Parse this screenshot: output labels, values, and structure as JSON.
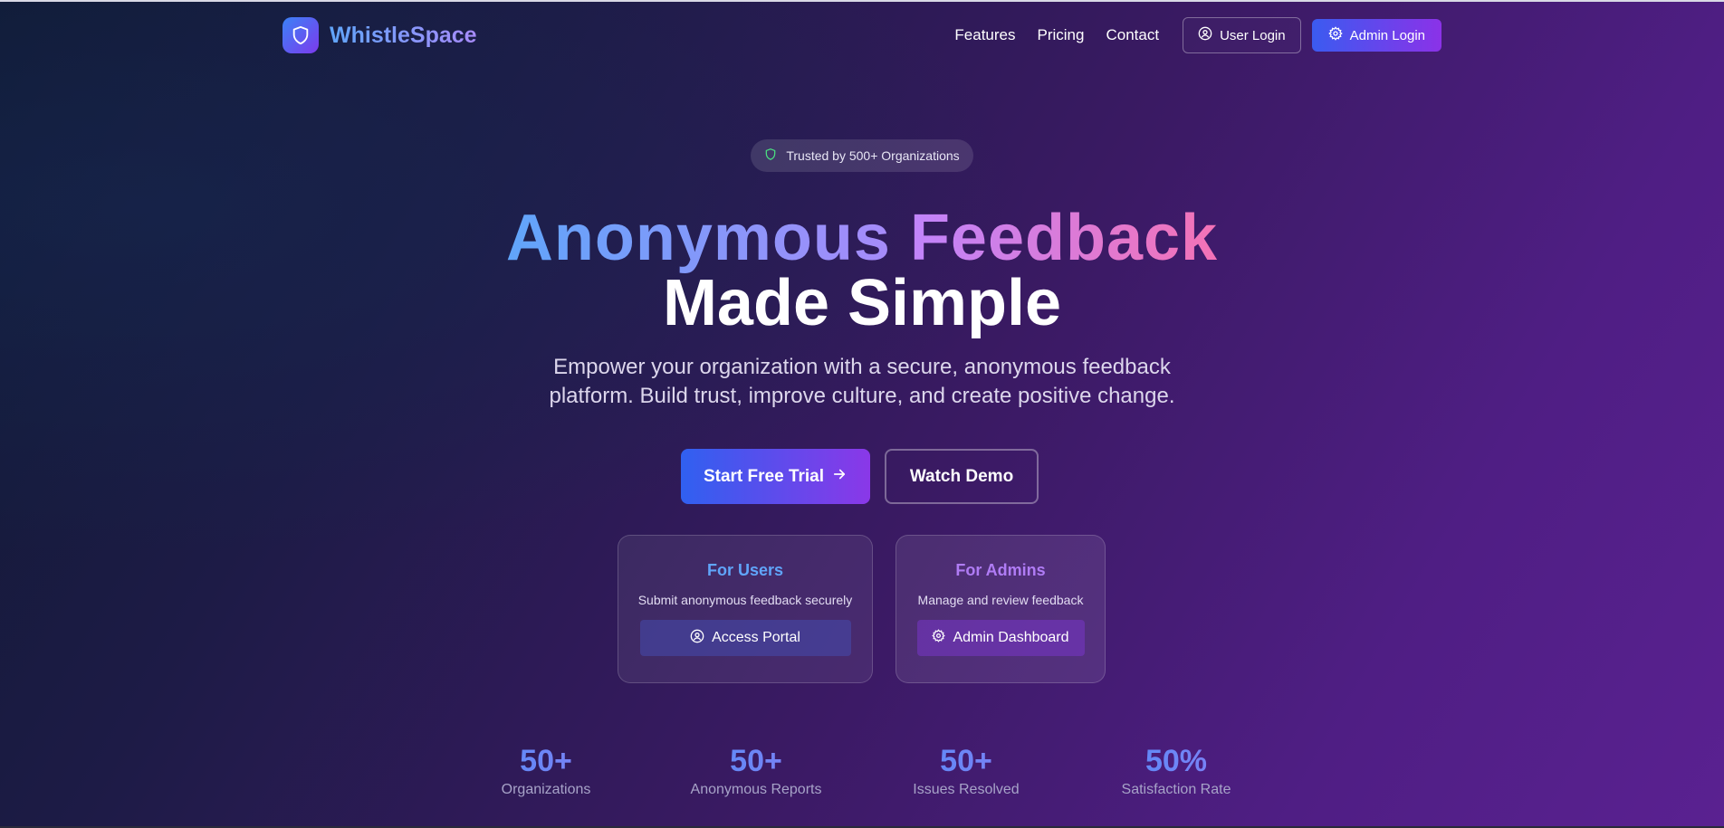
{
  "brand": {
    "name": "WhistleSpace",
    "logo_icon": "shield-icon"
  },
  "nav": {
    "links": [
      "Features",
      "Pricing",
      "Contact"
    ],
    "user_login": "User Login",
    "admin_login": "Admin Login"
  },
  "hero": {
    "badge": "Trusted by 500+ Organizations",
    "headline_part1": "Anonymous",
    "headline_part2": "Feedback",
    "headline_line2": "Made Simple",
    "subtitle_line1": "Empower your organization with a secure, anonymous feedback",
    "subtitle_line2": "platform. Build trust, improve culture, and create positive change.",
    "cta_primary": "Start Free Trial",
    "cta_secondary": "Watch Demo"
  },
  "cards": {
    "users": {
      "title": "For Users",
      "description": "Submit anonymous feedback securely",
      "button": "Access Portal"
    },
    "admins": {
      "title": "For Admins",
      "description": "Manage and review feedback",
      "button": "Admin Dashboard"
    }
  },
  "stats": [
    {
      "value": "50+",
      "label": "Organizations"
    },
    {
      "value": "50+",
      "label": "Anonymous Reports"
    },
    {
      "value": "50+",
      "label": "Issues Resolved"
    },
    {
      "value": "50%",
      "label": "Satisfaction Rate"
    }
  ],
  "colors": {
    "accent_blue": "#3b82f6",
    "accent_purple": "#7c3aed",
    "accent_pink": "#f472b6",
    "badge_shield": "#4ade80"
  }
}
